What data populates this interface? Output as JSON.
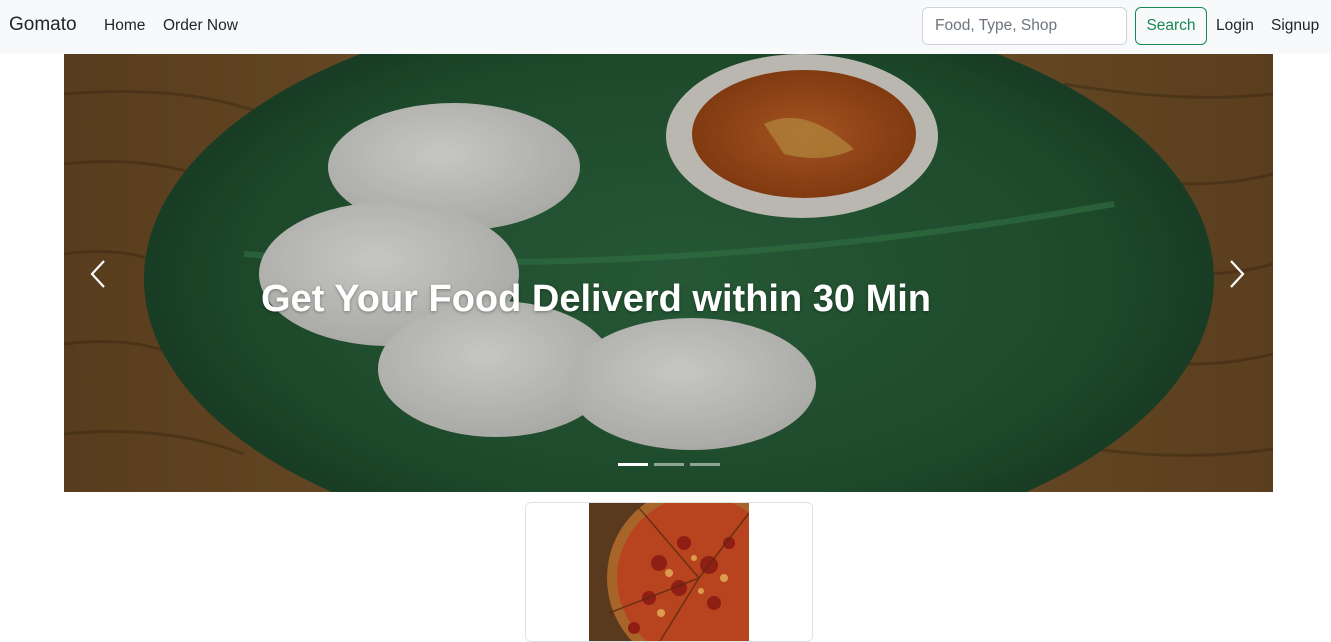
{
  "navbar": {
    "brand": "Gomato",
    "links": [
      "Home",
      "Order Now"
    ],
    "search": {
      "placeholder": "Food, Type, Shop",
      "value": ""
    },
    "search_button": "Search",
    "login": "Login",
    "signup": "Signup"
  },
  "carousel": {
    "caption": "Get Your Food Deliverd within 30 Min",
    "slides_count": 3,
    "active_slide": 1,
    "prev_icon": "chevron-left-icon",
    "next_icon": "chevron-right-icon"
  },
  "colors": {
    "navbar_bg": "#f8f9fa",
    "accent": "#198754",
    "text": "#212529"
  }
}
